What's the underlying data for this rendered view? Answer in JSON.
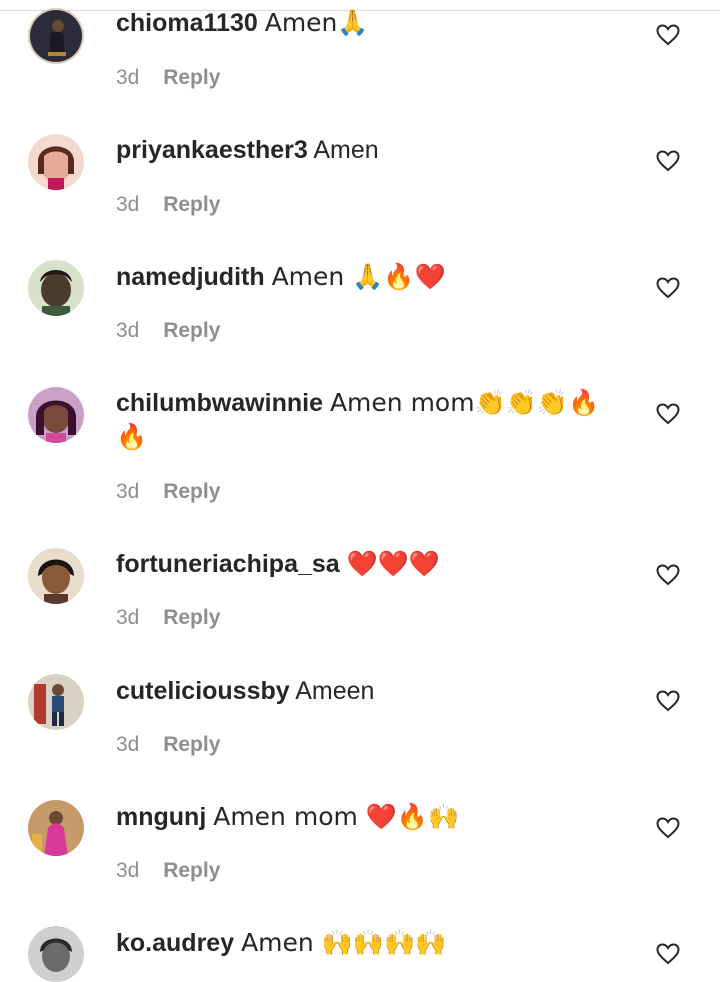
{
  "comments": [
    {
      "username": "chioma1130",
      "text": "Amen🙏",
      "time": "3d",
      "reply": "Reply",
      "avatar_color": "#2b2b3a"
    },
    {
      "username": "priyankaesther3",
      "text": "Amen",
      "time": "3d",
      "reply": "Reply",
      "avatar_color": "#e7a99a"
    },
    {
      "username": "namedjudith",
      "text": "Amen 🙏🔥❤️",
      "time": "3d",
      "reply": "Reply",
      "avatar_color": "#4a3b2c"
    },
    {
      "username": "chilumbwawinnie",
      "text": "Amen mom👏👏👏🔥🔥",
      "time": "3d",
      "reply": "Reply",
      "avatar_color": "#7a2f5a"
    },
    {
      "username": "fortuneriachipa_sa",
      "text": "❤️❤️❤️",
      "time": "3d",
      "reply": "Reply",
      "avatar_color": "#5a3a2a"
    },
    {
      "username": "cutelicioussby",
      "text": "Ameen",
      "time": "3d",
      "reply": "Reply",
      "avatar_color": "#c9b59a"
    },
    {
      "username": "mngunj",
      "text": "Amen mom ❤️🔥🙌",
      "time": "3d",
      "reply": "Reply",
      "avatar_color": "#b8408a"
    },
    {
      "username": "ko.audrey",
      "text": "Amen 🙌🙌🙌🙌",
      "time": "",
      "reply": "",
      "avatar_color": "#6b6b6b"
    }
  ],
  "colors": {
    "text": "#262626",
    "meta": "#8e8e8e",
    "heart_stroke": "#262626"
  },
  "icons": {
    "like": "heart-outline-icon"
  }
}
